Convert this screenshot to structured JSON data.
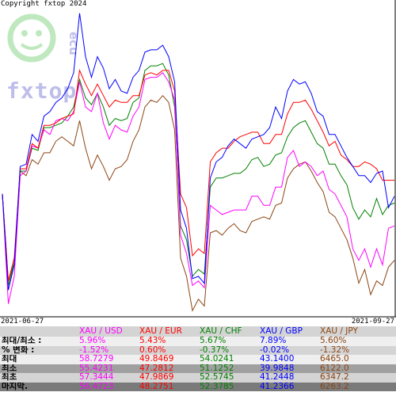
{
  "copyright": "Copyright fxtop 2024",
  "logo": {
    "text": "fxtop"
  },
  "chart_data": {
    "type": "line",
    "x_start_label": "2021-06-27",
    "x_end_label": "2021-09-27",
    "x_dates": [
      "2021-06-27",
      "2021-06-28",
      "2021-06-29",
      "2021-06-30",
      "2021-07-01",
      "2021-07-02",
      "2021-07-05",
      "2021-07-06",
      "2021-07-07",
      "2021-07-08",
      "2021-07-09",
      "2021-07-12",
      "2021-07-13",
      "2021-07-14",
      "2021-07-15",
      "2021-07-16",
      "2021-07-19",
      "2021-07-20",
      "2021-07-21",
      "2021-07-22",
      "2021-07-23",
      "2021-07-26",
      "2021-07-27",
      "2021-07-28",
      "2021-07-29",
      "2021-07-30",
      "2021-08-02",
      "2021-08-03",
      "2021-08-04",
      "2021-08-05",
      "2021-08-06",
      "2021-08-09",
      "2021-08-10",
      "2021-08-11",
      "2021-08-12",
      "2021-08-13",
      "2021-08-16",
      "2021-08-17",
      "2021-08-18",
      "2021-08-19",
      "2021-08-20",
      "2021-08-23",
      "2021-08-24",
      "2021-08-25",
      "2021-08-26",
      "2021-08-27",
      "2021-08-30",
      "2021-08-31",
      "2021-09-01",
      "2021-09-02",
      "2021-09-03",
      "2021-09-06",
      "2021-09-07",
      "2021-09-08",
      "2021-09-09",
      "2021-09-10",
      "2021-09-13",
      "2021-09-14",
      "2021-09-15",
      "2021-09-16",
      "2021-09-17",
      "2021-09-20",
      "2021-09-21",
      "2021-09-22",
      "2021-09-23",
      "2021-09-24",
      "2021-09-27"
    ],
    "series": [
      {
        "name": "XAU / USD",
        "color": "#ff00ff",
        "values": [
          0.0,
          -4.8,
          -3.6,
          0.8,
          1.0,
          2.1,
          2.0,
          2.8,
          2.6,
          3.2,
          3.3,
          3.2,
          3.6,
          4.9,
          3.8,
          3.6,
          4.4,
          3.1,
          2.4,
          3.0,
          2.8,
          2.7,
          3.4,
          3.8,
          5.0,
          5.1,
          5.1,
          5.3,
          4.9,
          4.1,
          -1.8,
          -2.6,
          -4.0,
          -3.8,
          -4.1,
          -0.5,
          -0.7,
          -0.9,
          -0.8,
          -0.7,
          -0.7,
          -0.7,
          -0.1,
          -0.1,
          -0.5,
          -0.5,
          0.3,
          0.3,
          1.6,
          1.9,
          1.2,
          1.4,
          1.2,
          0.8,
          1.0,
          0.2,
          0.0,
          -0.5,
          -1.0,
          -2.4,
          -2.9,
          -2.4,
          -3.2,
          -2.4,
          -3.1,
          -1.5,
          -1.4
        ]
      },
      {
        "name": "XAU / EUR",
        "color": "#ff0000",
        "values": [
          0.0,
          -3.8,
          -2.8,
          1.1,
          1.1,
          2.2,
          2.0,
          3.0,
          3.0,
          3.1,
          3.3,
          3.4,
          3.5,
          5.4,
          4.8,
          4.3,
          4.8,
          4.3,
          3.8,
          4.1,
          4.0,
          4.0,
          4.3,
          4.3,
          5.2,
          5.3,
          5.2,
          5.4,
          5.4,
          4.5,
          0.0,
          -0.6,
          -2.7,
          -2.4,
          -2.6,
          1.4,
          1.8,
          2.0,
          2.0,
          2.3,
          2.5,
          2.6,
          2.7,
          2.7,
          2.2,
          2.2,
          2.6,
          2.6,
          3.5,
          4.0,
          4.0,
          4.1,
          3.7,
          3.2,
          2.7,
          2.1,
          2.3,
          1.7,
          1.5,
          1.2,
          1.2,
          1.4,
          1.3,
          1.1,
          0.6,
          0.6,
          0.6
        ]
      },
      {
        "name": "XAU / CHF",
        "color": "#008000",
        "values": [
          0.0,
          -4.0,
          -3.0,
          1.0,
          1.0,
          2.0,
          1.9,
          2.9,
          2.9,
          3.0,
          3.1,
          3.4,
          3.8,
          5.0,
          4.2,
          3.9,
          4.4,
          3.8,
          3.0,
          3.3,
          3.2,
          3.3,
          4.0,
          4.2,
          5.4,
          5.6,
          5.6,
          5.7,
          5.2,
          3.8,
          -1.4,
          -2.0,
          -3.6,
          -3.3,
          -3.5,
          0.3,
          0.7,
          0.7,
          0.8,
          0.9,
          0.9,
          1.1,
          1.5,
          1.6,
          1.2,
          1.3,
          1.7,
          1.8,
          2.5,
          2.9,
          3.1,
          3.2,
          2.7,
          2.2,
          2.0,
          1.3,
          1.3,
          0.8,
          0.4,
          -0.6,
          -1.1,
          -0.7,
          -1.0,
          -0.2,
          -0.9,
          -0.5,
          -0.4
        ]
      },
      {
        "name": "XAU / GBP",
        "color": "#0000ff",
        "values": [
          0.0,
          -4.2,
          -3.1,
          1.2,
          1.3,
          2.6,
          2.3,
          3.4,
          3.6,
          4.0,
          4.2,
          4.6,
          5.3,
          7.9,
          6.0,
          5.1,
          6.0,
          5.5,
          4.6,
          5.0,
          4.5,
          4.4,
          5.1,
          5.4,
          6.2,
          6.3,
          6.3,
          6.5,
          6.0,
          4.9,
          -0.7,
          -1.5,
          -3.7,
          -3.6,
          -3.9,
          0.7,
          1.4,
          1.6,
          2.1,
          2.4,
          2.2,
          2.0,
          2.4,
          2.5,
          2.6,
          2.9,
          3.8,
          3.3,
          4.5,
          5.0,
          4.8,
          4.9,
          4.4,
          3.6,
          3.4,
          2.6,
          2.6,
          2.1,
          1.6,
          1.2,
          0.8,
          0.8,
          0.5,
          0.9,
          1.0,
          -0.6,
          -0.1
        ]
      },
      {
        "name": "XAU / JPY",
        "color": "#8b4513",
        "values": [
          0.0,
          -3.8,
          -3.0,
          1.0,
          0.8,
          1.5,
          1.3,
          1.8,
          1.8,
          2.3,
          2.5,
          2.3,
          2.1,
          3.2,
          2.0,
          1.1,
          1.7,
          1.2,
          0.6,
          1.1,
          1.2,
          1.5,
          2.3,
          2.8,
          3.8,
          4.1,
          4.0,
          4.3,
          4.0,
          2.8,
          -2.8,
          -3.6,
          -5.1,
          -4.6,
          -4.9,
          -1.7,
          -1.6,
          -1.8,
          -1.5,
          -1.3,
          -1.6,
          -1.7,
          -1.2,
          -1.1,
          -1.0,
          -1.1,
          -0.5,
          -0.4,
          0.7,
          1.1,
          1.3,
          1.4,
          1.0,
          0.5,
          0.1,
          -0.8,
          -1.0,
          -1.5,
          -2.0,
          -2.8,
          -3.9,
          -3.3,
          -4.4,
          -3.8,
          -4.0,
          -3.2,
          -2.9
        ]
      }
    ],
    "ylim": [
      -5.3,
      8.2
    ],
    "grid": false,
    "legend": "table-below"
  },
  "stats": {
    "headers": [
      "",
      "XAU / USD",
      "XAU / EUR",
      "XAU / CHF",
      "XAU / GBP",
      "XAU / JPY"
    ],
    "rows": [
      {
        "label": "최대/최소 :",
        "values": [
          "5.96%",
          "5.43%",
          "5.67%",
          "7.89%",
          "5.60%"
        ]
      },
      {
        "label": "% 변화 :",
        "values": [
          "-1.52%",
          "0.60%",
          "-0.37%",
          "-0.02%",
          "-1.32%"
        ]
      },
      {
        "label": "최대",
        "values": [
          "58.7279",
          "49.8469",
          "54.0241",
          "43.1400",
          "6465.0"
        ]
      },
      {
        "label": "최소",
        "values": [
          "55.4231",
          "47.2812",
          "51.1252",
          "39.9848",
          "6122.0"
        ]
      },
      {
        "label": "최초",
        "values": [
          "57.3444",
          "47.9869",
          "52.5745",
          "41.2448",
          "6347.2"
        ]
      },
      {
        "label": "마지막.",
        "values": [
          "56.4723",
          "48.2751",
          "52.3785",
          "41.2366",
          "6263.2"
        ]
      }
    ]
  },
  "colors": {
    "usd": "#ff00ff",
    "eur": "#ff0000",
    "chf": "#008000",
    "gbp": "#0000ff",
    "jpy": "#8b4513"
  }
}
